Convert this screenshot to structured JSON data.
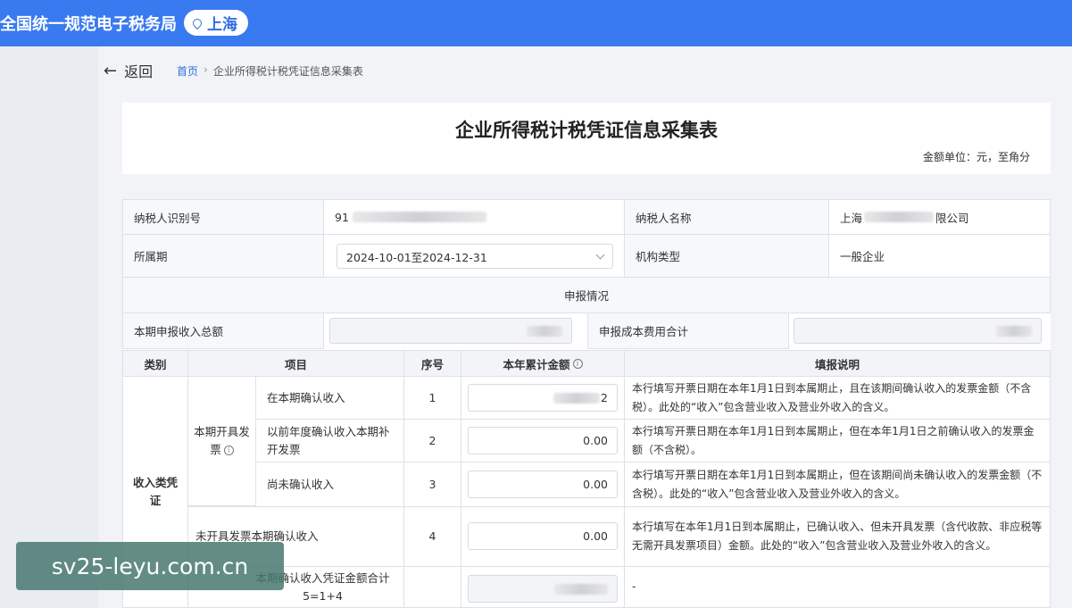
{
  "header": {
    "site_title": "全国统一规范电子税务局",
    "region": "上海",
    "region_icon": "location-pin-icon"
  },
  "nav": {
    "back_label": "返回",
    "breadcrumb_home": "首页",
    "breadcrumb_sep": "›",
    "breadcrumb_current": "企业所得税计税凭证信息采集表"
  },
  "form": {
    "title": "企业所得税计税凭证信息采集表",
    "unit_note": "金额单位：元，至角分",
    "taxpayer_id_label": "纳税人识别号",
    "taxpayer_id_value": "91",
    "taxpayer_name_label": "纳税人名称",
    "taxpayer_name_prefix": "上海",
    "taxpayer_name_suffix": "限公司",
    "period_label": "所属期",
    "period_value": "2024-10-01至2024-12-31",
    "org_type_label": "机构类型",
    "org_type_value": "一般企业",
    "declaration_section": "申报情况",
    "declared_income_label": "本期申报收入总额",
    "declared_cost_label": "申报成本费用合计"
  },
  "table": {
    "headers": {
      "category": "类别",
      "item": "项目",
      "seq": "序号",
      "amount": "本年累计金额",
      "description": "填报说明"
    },
    "category_income": "收入类凭证",
    "group_invoiced": "本期开具发票",
    "rows": [
      {
        "item": "在本期确认收入",
        "seq": "1",
        "amount": "2",
        "desc": "本行填写开票日期在本年1月1日到本属期止，且在该期间确认收入的发票金额（不含税）。此处的“收入”包含营业收入及营业外收入的含义。"
      },
      {
        "item": "以前年度确认收入本期补开发票",
        "seq": "2",
        "amount": "0.00",
        "desc": "本行填写开票日期在本年1月1日到本属期止，但在本年1月1日之前确认收入的发票金额（不含税）。"
      },
      {
        "item": "尚未确认收入",
        "seq": "3",
        "amount": "0.00",
        "desc": "本行填写开票日期在本年1月1日到本属期止，但在该期间尚未确认收入的发票金额（不含税）。此处的“收入”包含营业收入及营业外收入的含义。"
      },
      {
        "item": "未开具发票本期确认收入",
        "seq": "4",
        "amount": "0.00",
        "desc": "本行填写在本年1月1日到本属期止，已确认收入、但未开具发票（含代收款、非应税等无需开具发票项目）金额。此处的“收入”包含营业收入及营业外收入的含义。"
      },
      {
        "item": "本期确认收入凭证金额合计",
        "formula": "5=1+4",
        "seq": "",
        "amount": "",
        "desc": "-"
      }
    ]
  },
  "watermark": "sv25-leyu.com.cn",
  "colors": {
    "brand_blue": "#3a7af0",
    "link_blue": "#2f6fe0"
  }
}
